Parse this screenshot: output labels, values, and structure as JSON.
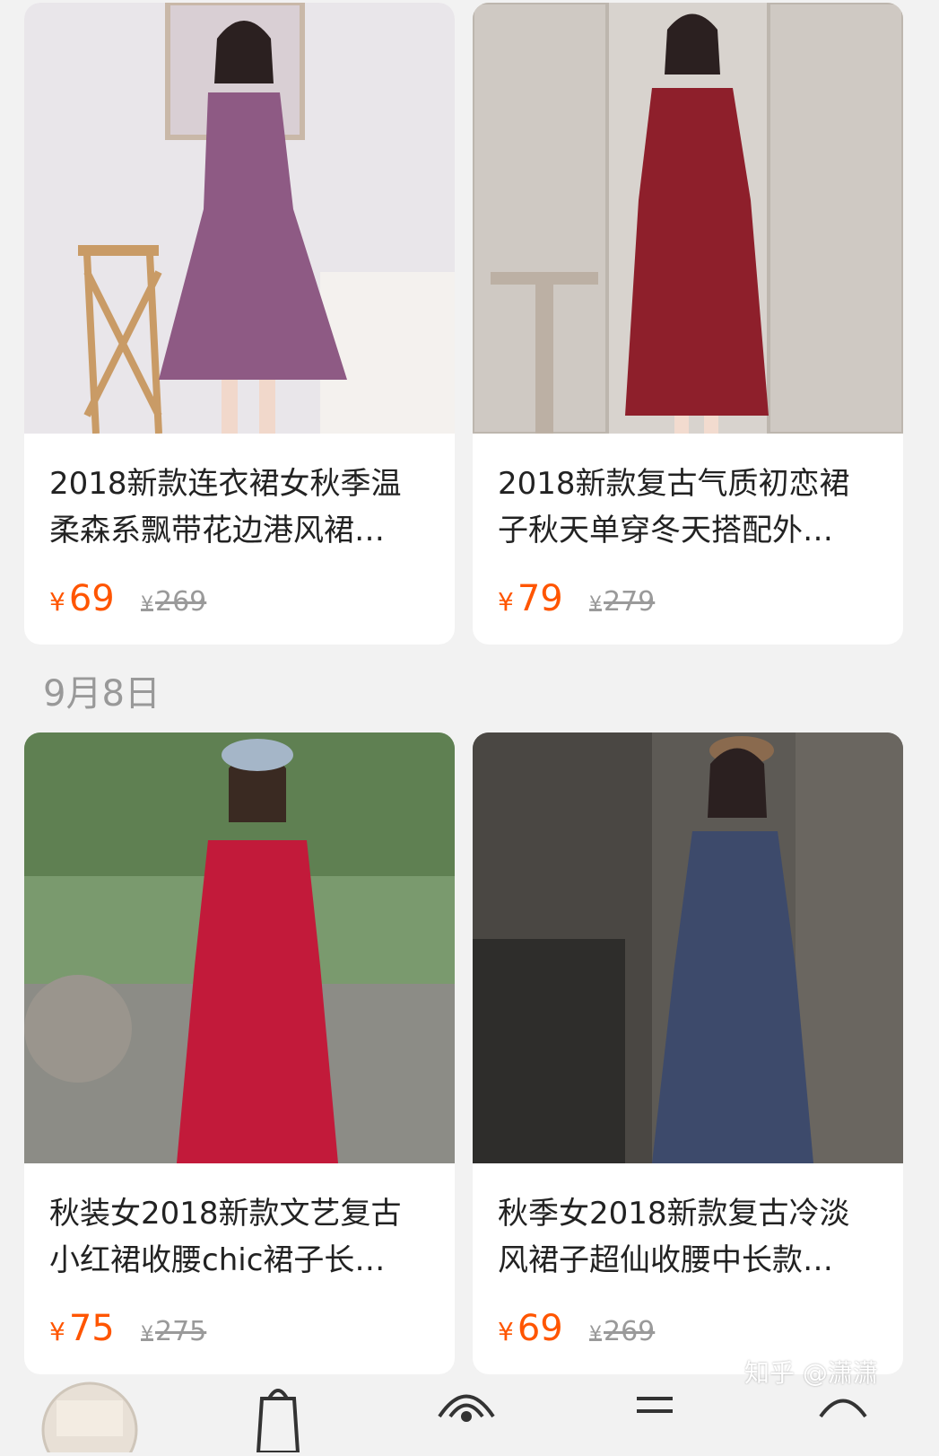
{
  "products": [
    {
      "title": "2018新款连衣裙女秋季温柔森系飘带花边港风裙…",
      "currency": "¥",
      "price": "69",
      "original_price": "269",
      "image": "purple-dress-photo"
    },
    {
      "title": "2018新款复古气质初恋裙子秋天单穿冬天搭配外…",
      "currency": "¥",
      "price": "79",
      "original_price": "279",
      "image": "burgundy-dress-photo"
    },
    {
      "title": "秋装女2018新款文艺复古小红裙收腰chic裙子长…",
      "currency": "¥",
      "price": "75",
      "original_price": "275",
      "image": "red-dress-photo"
    },
    {
      "title": "秋季女2018新款复古冷淡风裙子超仙收腰中长款…",
      "currency": "¥",
      "price": "69",
      "original_price": "269",
      "image": "plaid-dress-photo"
    }
  ],
  "date_section": "9月8日",
  "watermark": "知乎 @潇潇",
  "bottom_nav": {
    "icons": [
      "shop-avatar-icon",
      "bag-icon",
      "live-icon",
      "list-icon",
      "chat-icon"
    ]
  },
  "colors": {
    "price": "#ff5500",
    "background": "#f2f2f2"
  }
}
